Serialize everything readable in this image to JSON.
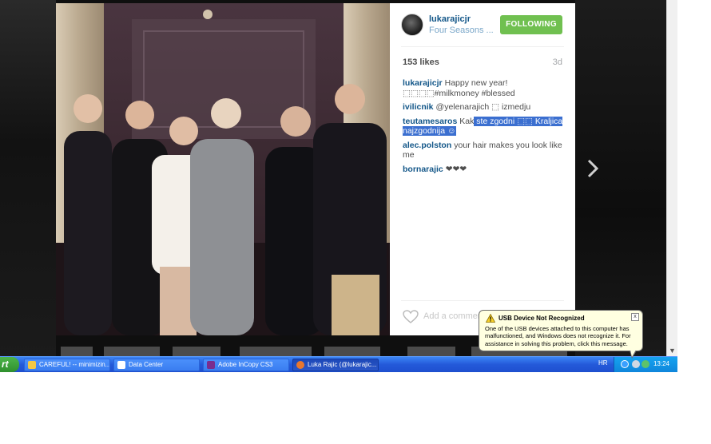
{
  "post": {
    "username": "lukarajicjr",
    "location": "Four Seasons ...",
    "follow_label": "FOLLOWING",
    "likes": "153 likes",
    "age": "3d",
    "comments": [
      {
        "user": "lukarajicjr",
        "text": "Happy new year!⬚⬚⬚⬚#milkmoney #blessed",
        "highlight": ""
      },
      {
        "user": "ivilicnik",
        "text": "@yelenarajich ⬚ izmedju",
        "highlight": ""
      },
      {
        "user": "teutamesaros",
        "text": "Kak",
        "highlight": " ste zgodni ⬚⬚ Kraljica najzgodnija ☺"
      },
      {
        "user": "alec.polston",
        "text": "your hair makes you look like me",
        "highlight": ""
      },
      {
        "user": "bornarajic",
        "text": "❤❤❤",
        "highlight": ""
      }
    ],
    "add_comment_placeholder": "Add a comment..."
  },
  "taskbar": {
    "start_label": "rt",
    "tasks": [
      {
        "label": "CAREFUL! -- minimizin...",
        "icon_color": "#f2c744"
      },
      {
        "label": "Data Center",
        "icon_color": "#ffffff"
      },
      {
        "label": "Adobe InCopy CS3",
        "icon_color": "#7a2d8f"
      },
      {
        "label": "Luka Rajic (@lukarajic...",
        "icon_color": "#e8772e"
      }
    ],
    "language": "HR",
    "clock": "13:24"
  },
  "balloon": {
    "title": "USB Device Not Recognized",
    "body": "One of the USB devices attached to this computer has malfunctioned, and Windows does not recognize it. For assistance in solving this problem, click this message.",
    "close_label": "x"
  },
  "colors": {
    "follow_green": "#70c050",
    "username_blue": "#125688",
    "taskbar_blue": "#2459d9",
    "balloon_bg": "#ffffe1"
  }
}
